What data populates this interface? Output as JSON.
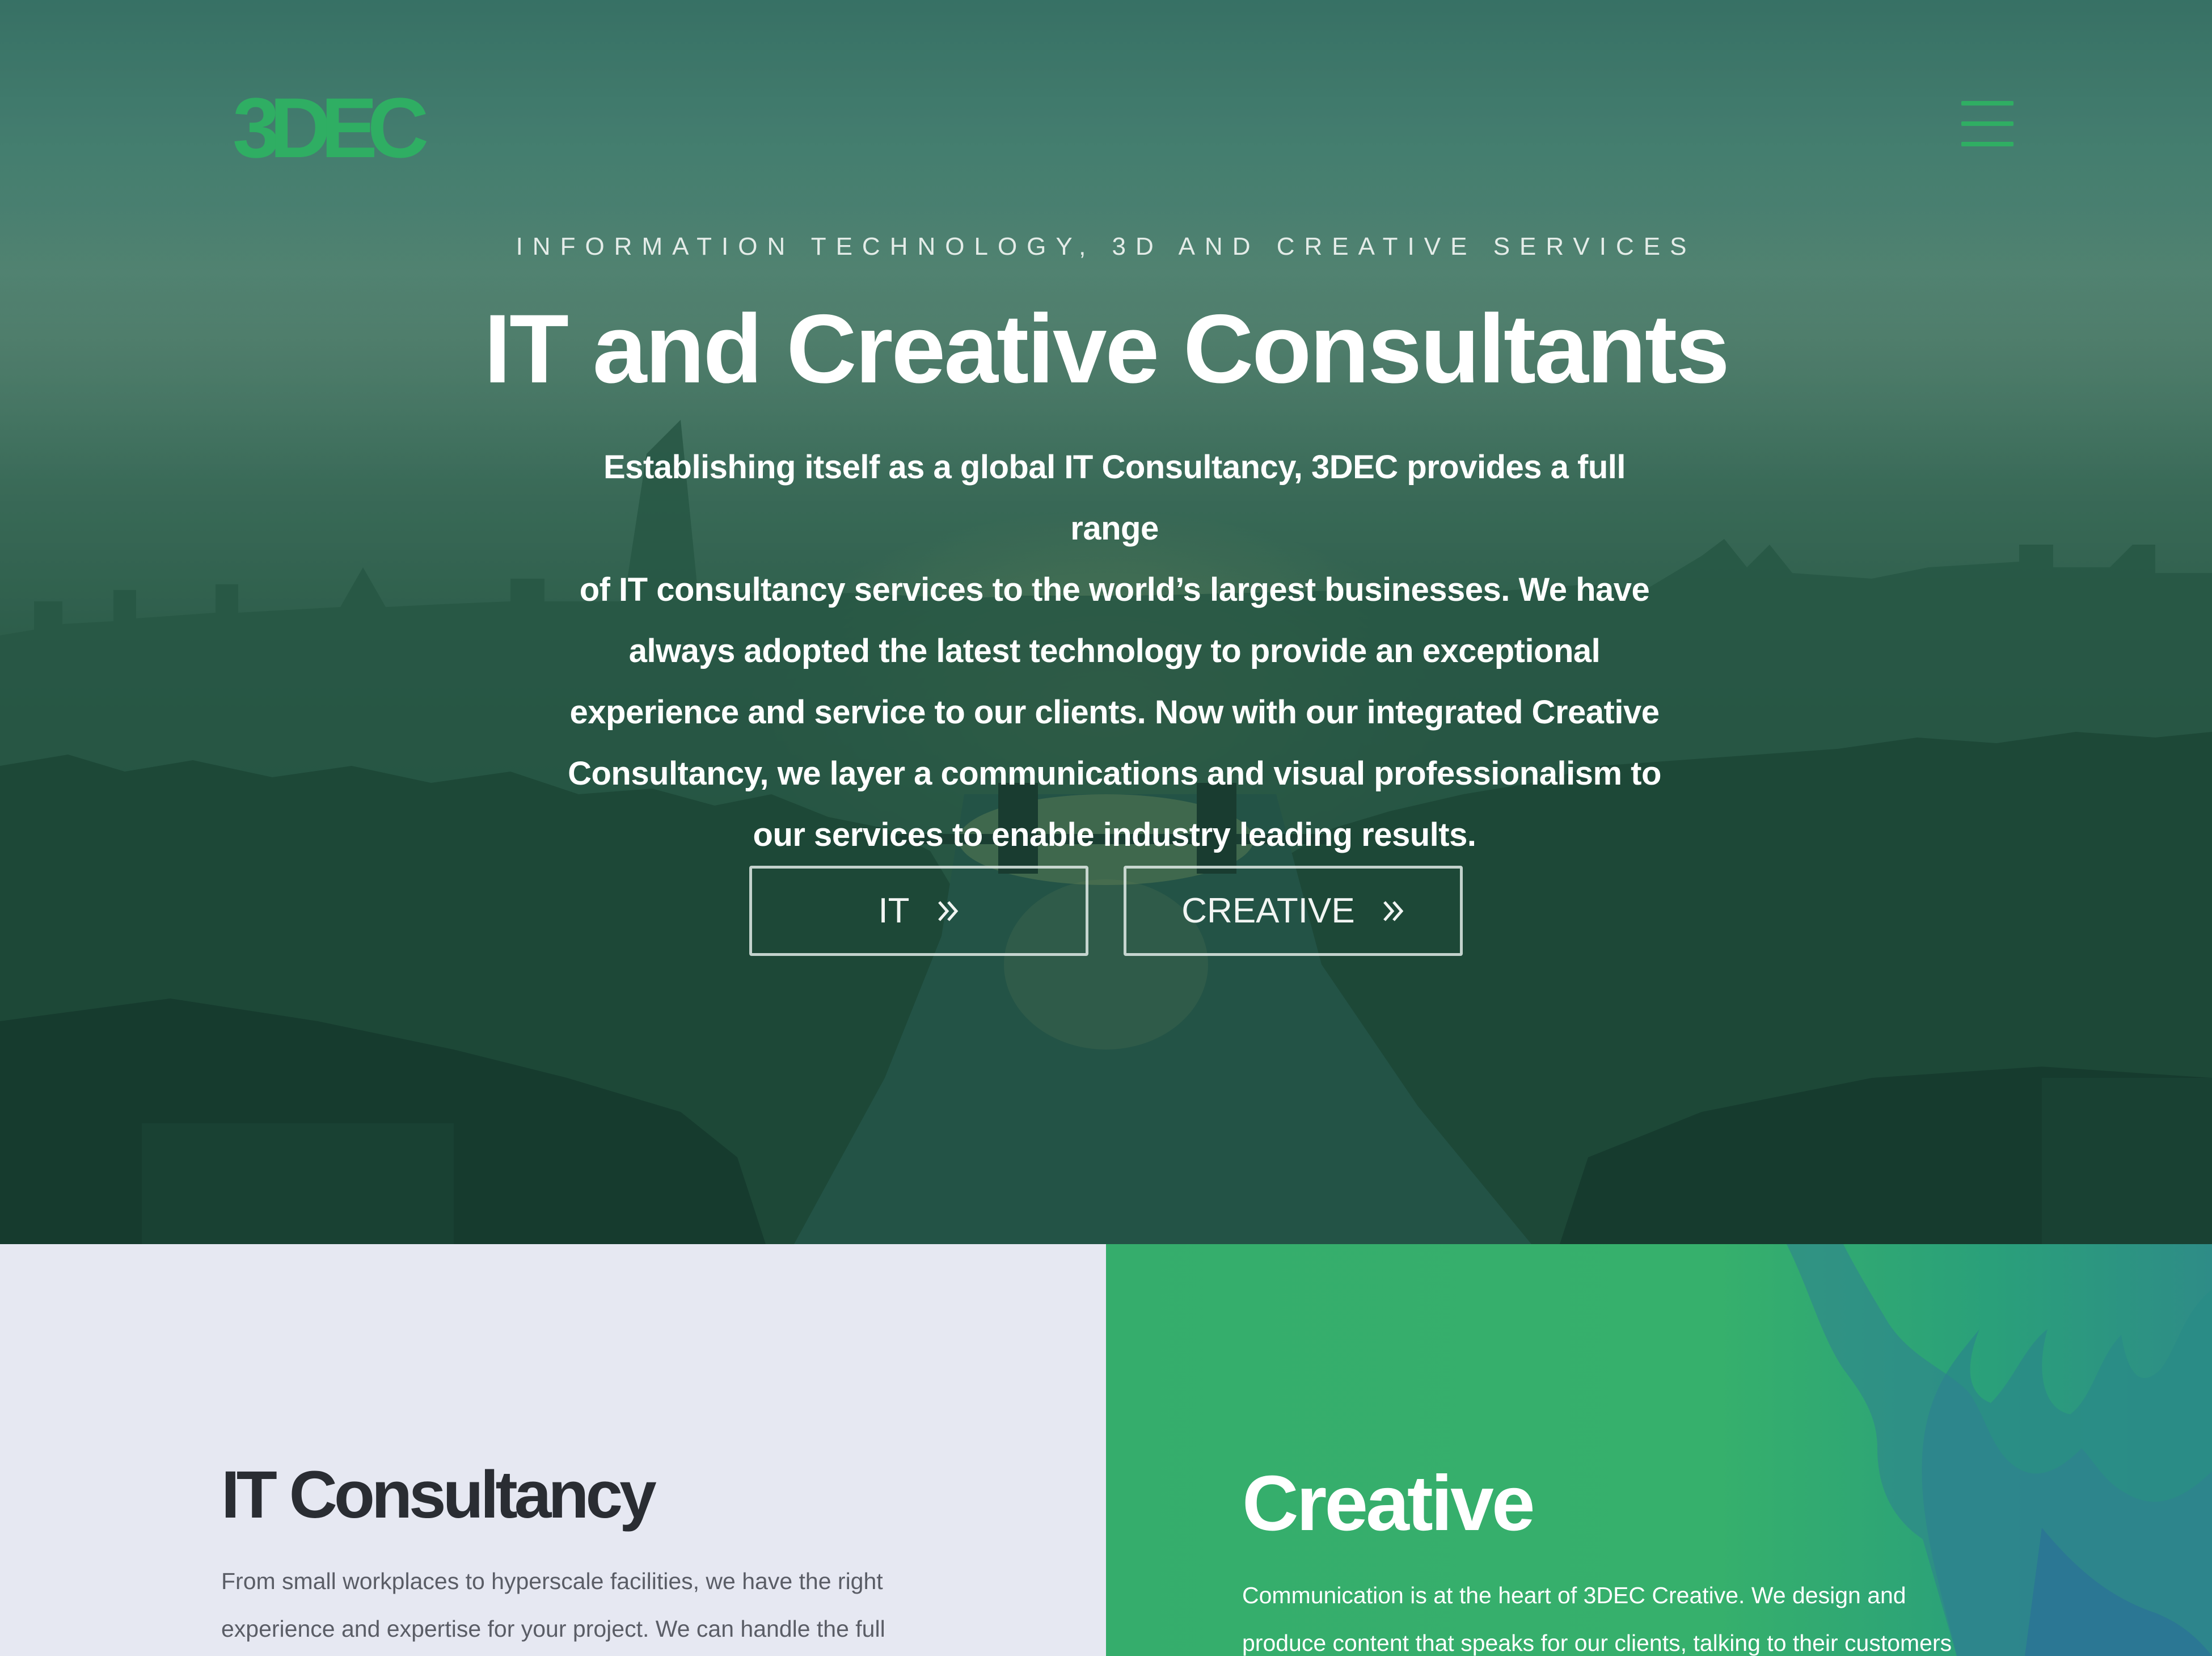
{
  "header": {
    "logo_text": "3DEC",
    "menu_icon": "hamburger-menu-icon",
    "brand_color": "#2fae63"
  },
  "hero": {
    "eyebrow": "INFORMATION TECHNOLOGY, 3D AND CREATIVE SERVICES",
    "title": "IT and Creative Consultants",
    "lines": [
      "Establishing itself as a global IT Consultancy, 3DEC provides a full range",
      "of IT consultancy services to the world’s largest businesses. We have",
      "always adopted the latest technology to provide an exceptional",
      "experience and service to our clients. Now with our integrated Creative",
      "Consultancy, we layer a communications and visual professionalism to",
      "our services to enable industry leading results."
    ],
    "buttons": {
      "it_label": "IT",
      "creative_label": "CREATIVE",
      "chevron_icon": "double-chevron-right-icon"
    }
  },
  "it_panel": {
    "title": "IT Consultancy",
    "lines": [
      "From small workplaces to hyperscale facilities, we have the right",
      "experience and expertise for your project. We can handle the full"
    ],
    "background": "#e6e8f2"
  },
  "creative_panel": {
    "title": "Creative",
    "lines": [
      "Communication is at the heart of 3DEC Creative. We design and",
      "produce content that speaks for our clients, talking to their customers"
    ],
    "background": "#35ad6c"
  }
}
